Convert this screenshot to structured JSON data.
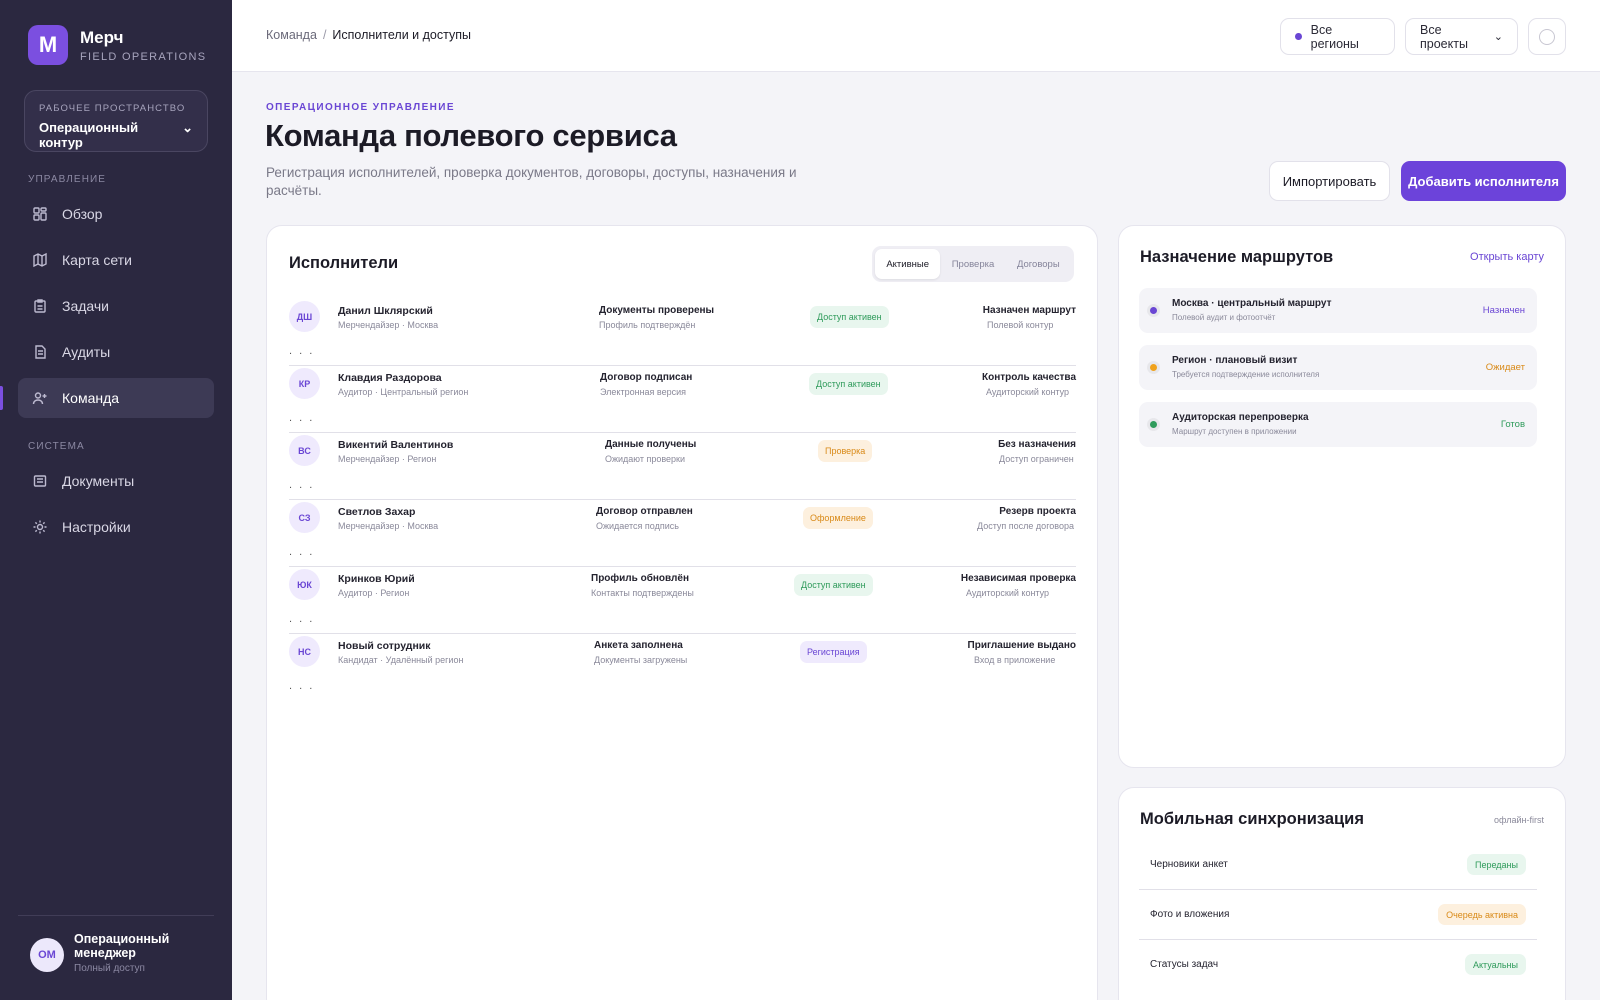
{
  "brand": {
    "letter": "M",
    "name": "Мерч",
    "sub": "FIELD OPERATIONS"
  },
  "workspace": {
    "label": "РАБОЧЕЕ ПРОСТРАНСТВО",
    "value": "Операционный контур",
    "chevron": "⌄"
  },
  "sidebar": {
    "section_manage": "УПРАВЛЕНИЕ",
    "section_system": "СИСТЕМА",
    "items": [
      {
        "label": "Обзор",
        "icon": "dashboard-icon"
      },
      {
        "label": "Карта сети",
        "icon": "map-icon"
      },
      {
        "label": "Задачи",
        "icon": "tasks-icon"
      },
      {
        "label": "Аудиты",
        "icon": "audit-icon"
      },
      {
        "label": "Команда",
        "icon": "team-icon",
        "active": true
      },
      {
        "label": "Документы",
        "icon": "documents-icon"
      },
      {
        "label": "Настройки",
        "icon": "settings-icon"
      }
    ]
  },
  "user": {
    "initials": "ОМ",
    "name": "Операционный менеджер",
    "role": "Полный доступ"
  },
  "topbar": {
    "breadcrumb": {
      "parent": "Команда",
      "separator": "/",
      "current": "Исполнители и доступы"
    },
    "regions": "Все регионы",
    "projects": "Все проекты",
    "projects_chevron": "⌄"
  },
  "header": {
    "kicker": "ОПЕРАЦИОННОЕ УПРАВЛЕНИЕ",
    "title": "Команда полевого сервиса",
    "subtitle": "Регистрация исполнителей, проверка документов, договоры, доступы, назначения и расчёты.",
    "import_label": "Импортировать",
    "add_label": "Добавить исполнителя"
  },
  "executors": {
    "title": "Исполнители",
    "tabs": [
      "Активные",
      "Проверка",
      "Договоры"
    ],
    "ellipsis": ". . .",
    "rows": [
      {
        "initials": "ДШ",
        "name": "Данил Шклярский",
        "role": "Мерчендайзер · Москва",
        "doc": "Документы проверены",
        "doc_sub": "Профиль подтверждён",
        "status": "Доступ активен",
        "status_color": "green",
        "assign": "Назначен маршрут",
        "assign_sub": "Полевой контур"
      },
      {
        "initials": "КР",
        "name": "Клавдия Раздорова",
        "role": "Аудитор · Центральный регион",
        "doc": "Договор подписан",
        "doc_sub": "Электронная версия",
        "status": "Доступ активен",
        "status_color": "green",
        "assign": "Контроль качества",
        "assign_sub": "Аудиторский контур"
      },
      {
        "initials": "ВС",
        "name": "Викентий Валентинов",
        "role": "Мерчендайзер · Регион",
        "doc": "Данные получены",
        "doc_sub": "Ожидают проверки",
        "status": "Проверка",
        "status_color": "orange",
        "assign": "Без назначения",
        "assign_sub": "Доступ ограничен"
      },
      {
        "initials": "СЗ",
        "name": "Светлов Захар",
        "role": "Мерчендайзер · Москва",
        "doc": "Договор отправлен",
        "doc_sub": "Ожидается подпись",
        "status": "Оформление",
        "status_color": "orange",
        "assign": "Резерв проекта",
        "assign_sub": "Доступ после договора"
      },
      {
        "initials": "ЮК",
        "name": "Кринков Юрий",
        "role": "Аудитор · Регион",
        "doc": "Профиль обновлён",
        "doc_sub": "Контакты подтверждены",
        "status": "Доступ активен",
        "status_color": "green",
        "assign": "Независимая проверка",
        "assign_sub": "Аудиторский контур"
      },
      {
        "initials": "НС",
        "name": "Новый сотрудник",
        "role": "Кандидат · Удалённый регион",
        "doc": "Анкета заполнена",
        "doc_sub": "Документы загружены",
        "status": "Регистрация",
        "status_color": "purple",
        "assign": "Приглашение выдано",
        "assign_sub": "Вход в приложение"
      }
    ]
  },
  "routes": {
    "title": "Назначение маршрутов",
    "link": "Открыть карту",
    "items": [
      {
        "title": "Москва · центральный маршрут",
        "sub": "Полевой аудит и фотоотчёт",
        "status": "Назначен",
        "color": "#6a46d4"
      },
      {
        "title": "Регион · плановый визит",
        "sub": "Требуется подтверждение исполнителя",
        "status": "Ожидает",
        "color": "#f0a21c"
      },
      {
        "title": "Аудиторская перепроверка",
        "sub": "Маршрут доступен в приложении",
        "status": "Готов",
        "color": "#2f9b5b"
      }
    ]
  },
  "sync": {
    "title": "Мобильная синхронизация",
    "meta": "офлайн-first",
    "items": [
      {
        "label": "Черновики анкет",
        "status": "Переданы",
        "color": "green"
      },
      {
        "label": "Фото и вложения",
        "status": "Очередь активна",
        "color": "orange"
      },
      {
        "label": "Статусы задач",
        "status": "Актуальны",
        "color": "green"
      }
    ]
  }
}
